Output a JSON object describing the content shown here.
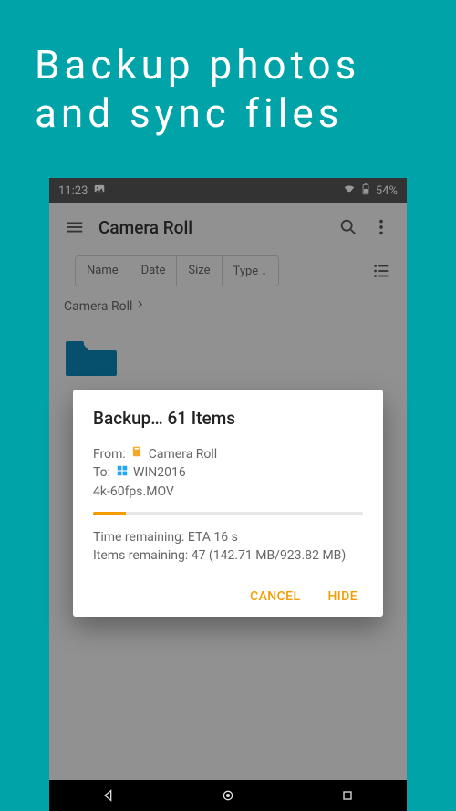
{
  "promo": {
    "headline": "Backup photos and sync files"
  },
  "statusbar": {
    "time": "11:23",
    "battery": "54%"
  },
  "appbar": {
    "title": "Camera Roll"
  },
  "sortchips": {
    "name": "Name",
    "date": "Date",
    "size": "Size",
    "type": "Type ↓"
  },
  "breadcrumb": {
    "path": "Camera Roll"
  },
  "modal": {
    "title": "Backup… 61 Items",
    "from_label": "From:",
    "from_value": "Camera Roll",
    "to_label": "To:",
    "to_value": "WIN2016",
    "current_file": "4k-60fps.MOV",
    "progress_percent": 12,
    "eta_line": "Time remaining: ETA 16 s",
    "items_line": "Items remaining: 47 (142.71 MB/923.82 MB)",
    "cancel": "CANCEL",
    "hide": "HIDE"
  }
}
